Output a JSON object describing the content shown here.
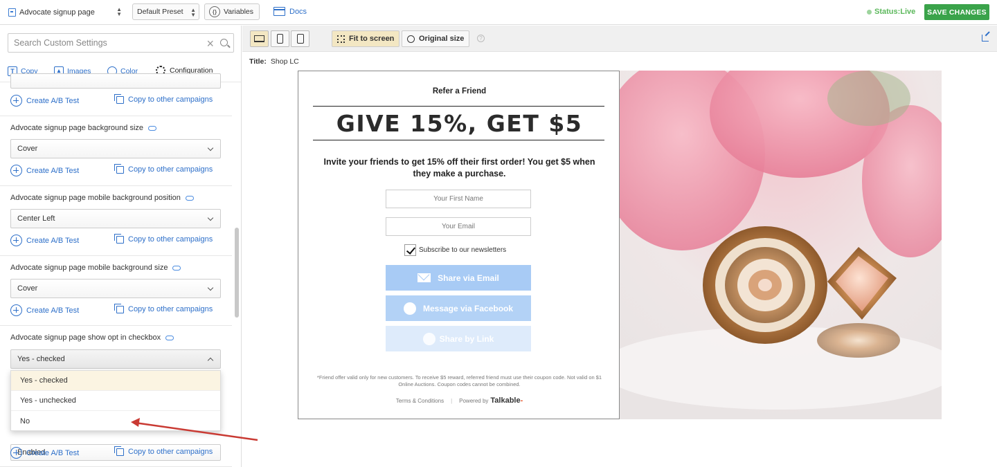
{
  "topbar": {
    "page_select": "Advocate signup page",
    "preset": "Default Preset",
    "variables": "Variables",
    "docs": "Docs",
    "status": "Status:Live",
    "save": "SAVE CHANGES"
  },
  "sidebar": {
    "search_placeholder": "Search Custom Settings",
    "tabs": [
      "Copy",
      "Images",
      "Color",
      "Configuration"
    ],
    "create_ab": "Create A/B Test",
    "copy_other": "Copy to other campaigns",
    "sections": [
      {
        "label": "Advocate signup page background size",
        "value": "Cover"
      },
      {
        "label": "Advocate signup page mobile background position",
        "value": "Center Left"
      },
      {
        "label": "Advocate signup page mobile background size",
        "value": "Cover"
      },
      {
        "label": "Advocate signup page show opt in checkbox",
        "value": "Yes - checked"
      }
    ],
    "next_value": "Enabled",
    "dropdown": [
      "Yes - checked",
      "Yes - unchecked",
      "No"
    ]
  },
  "preview": {
    "fit": "Fit to screen",
    "original": "Original size",
    "help": "?",
    "title_label": "Title:",
    "title_value": "Shop LC",
    "card": {
      "refer": "Refer a Friend",
      "headline": "GIVE 15%, GET $5",
      "subtext": "Invite your friends to get 15% off their first order! You get $5 when they make a purchase.",
      "first_name": "Your First Name",
      "email": "Your Email",
      "subscribe": "Subscribe to our newsletters",
      "share_email": "Share via Email",
      "share_fb": "Message via Facebook",
      "share_link": "Share by Link",
      "fine_print": "*Friend offer valid only for new customers. To receive $5 reward, referred friend must use their coupon code. Not valid on $1 Online Auctions. Coupon codes cannot be combined.",
      "terms": "Terms & Conditions",
      "powered": "Powered by",
      "brand": "Talkable"
    }
  },
  "colors": {
    "accent": "#2d6fc9",
    "save": "#3aa34a",
    "tab_active": "#e8552c",
    "arrow": "#c93a33"
  }
}
